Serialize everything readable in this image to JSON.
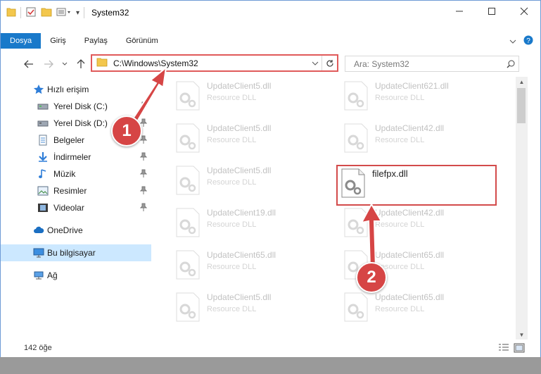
{
  "window": {
    "title": "System32",
    "minimize_icon": "minimize-icon",
    "maximize_icon": "maximize-icon",
    "close_icon": "close-icon"
  },
  "ribbon": {
    "tabs": [
      {
        "label": "Dosya",
        "active": true
      },
      {
        "label": "Giriş",
        "active": false
      },
      {
        "label": "Paylaş",
        "active": false
      },
      {
        "label": "Görünüm",
        "active": false
      }
    ]
  },
  "address": {
    "path": "C:\\Windows\\System32",
    "search_placeholder": "Ara: System32"
  },
  "nav": {
    "items": [
      {
        "label": "Hızlı erişim",
        "icon": "star-icon",
        "pinned": false
      },
      {
        "label": "Yerel Disk (C:)",
        "icon": "drive-icon",
        "pinned": true
      },
      {
        "label": "Yerel Disk (D:)",
        "icon": "drive-icon",
        "pinned": true
      },
      {
        "label": "Belgeler",
        "icon": "documents-icon",
        "pinned": true
      },
      {
        "label": "İndirmeler",
        "icon": "download-icon",
        "pinned": true
      },
      {
        "label": "Müzik",
        "icon": "music-icon",
        "pinned": true
      },
      {
        "label": "Resimler",
        "icon": "pictures-icon",
        "pinned": true
      },
      {
        "label": "Videolar",
        "icon": "videos-icon",
        "pinned": true
      },
      {
        "label": "OneDrive",
        "icon": "cloud-icon",
        "pinned": false
      },
      {
        "label": "Bu bilgisayar",
        "icon": "computer-icon",
        "pinned": false,
        "selected": true
      },
      {
        "label": "Ağ",
        "icon": "network-icon",
        "pinned": false
      }
    ]
  },
  "files": [
    {
      "name": "UpdateClient5.dll",
      "type": "Resource DLL"
    },
    {
      "name": "UpdateClient621.dll",
      "type": "Resource DLL"
    },
    {
      "name": "UpdateClient5.dll",
      "type": "Resource DLL"
    },
    {
      "name": "UpdateClient42.dll",
      "type": "Resource DLL"
    },
    {
      "name": "UpdateClient5.dll",
      "type": "Resource DLL"
    },
    {
      "name": "filefpx.dll",
      "type": ""
    },
    {
      "name": "UpdateClient19.dll",
      "type": "Resource DLL"
    },
    {
      "name": "UpdateClient42.dll",
      "type": "Resource DLL"
    },
    {
      "name": "UpdateClient65.dll",
      "type": "Resource DLL"
    },
    {
      "name": "UpdateClient65.dll",
      "type": "Resource DLL"
    },
    {
      "name": "UpdateClient5.dll",
      "type": "Resource DLL"
    },
    {
      "name": "UpdateClient65.dll",
      "type": "Resource DLL"
    }
  ],
  "status": {
    "item_count": "142 öğe"
  },
  "callouts": {
    "first": "1",
    "second": "2"
  },
  "colors": {
    "accent": "#1979ca",
    "highlight_red": "#d64545",
    "selected_bg": "#cce8ff"
  }
}
